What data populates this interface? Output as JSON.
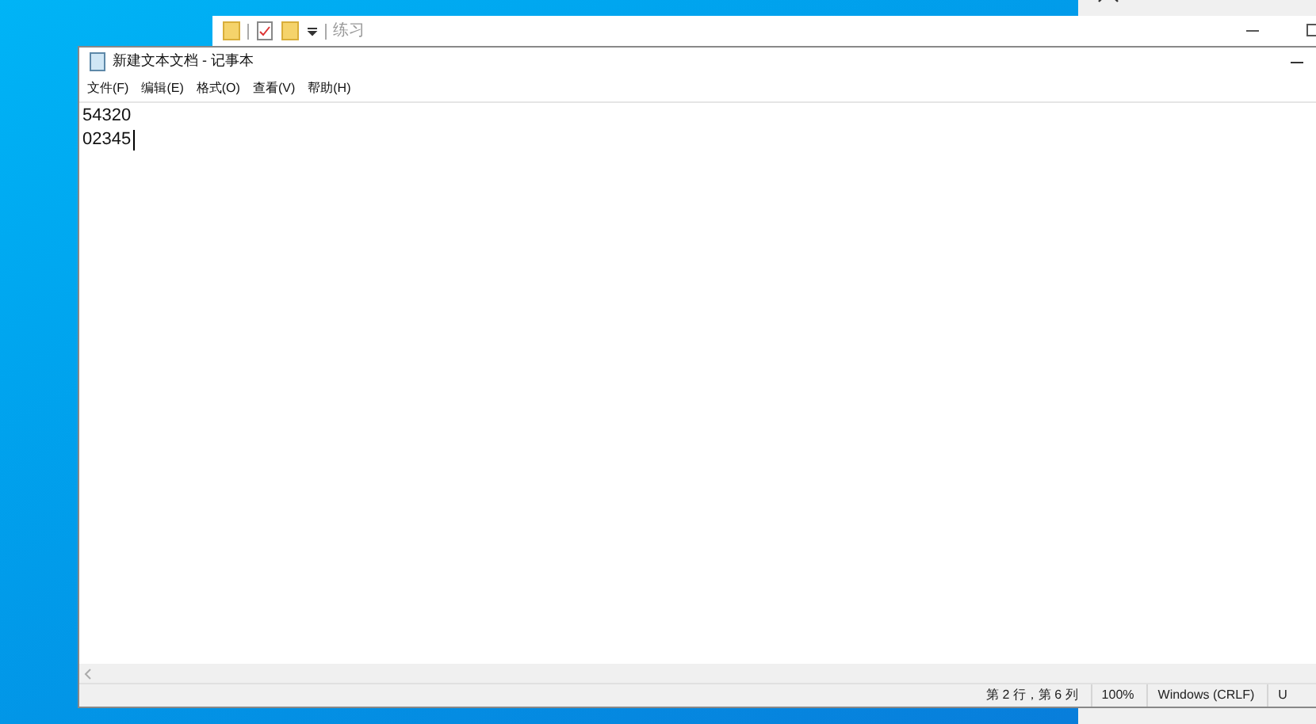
{
  "explorer": {
    "title": "练习"
  },
  "notepad": {
    "title": "新建文本文档 - 记事本",
    "menu": [
      "文件(F)",
      "编辑(E)",
      "格式(O)",
      "查看(V)",
      "帮助(H)"
    ],
    "lines": [
      "54320",
      "02345"
    ],
    "status_bar": [
      "第 2 行，第 6 列",
      "100%",
      "Windows (CRLF)",
      "U"
    ]
  }
}
